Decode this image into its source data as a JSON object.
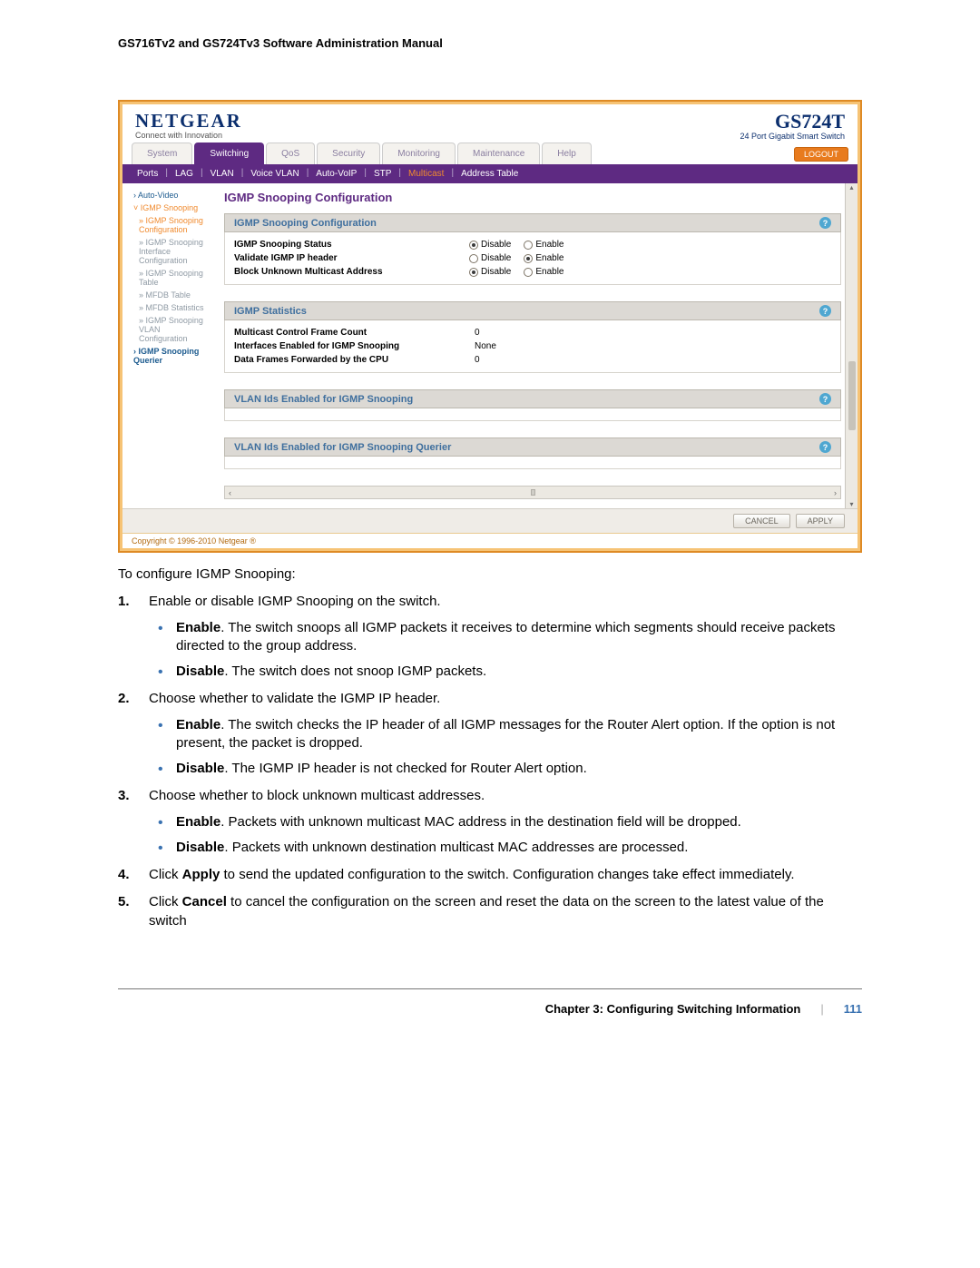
{
  "doc": {
    "header_title": "GS716Tv2 and GS724Tv3 Software Administration Manual"
  },
  "ui": {
    "brand": "NETGEAR",
    "brand_tagline": "Connect with Innovation",
    "model": "GS724T",
    "model_sub": "24 Port Gigabit Smart Switch",
    "logout": "LOGOUT",
    "main_tabs": [
      "System",
      "Switching",
      "QoS",
      "Security",
      "Monitoring",
      "Maintenance",
      "Help"
    ],
    "main_active_index": 1,
    "sub_tabs": [
      "Ports",
      "LAG",
      "VLAN",
      "Voice VLAN",
      "Auto-VoIP",
      "STP",
      "Multicast",
      "Address Table"
    ],
    "sub_active_index": 6,
    "sidebar": {
      "auto_video": "Auto-Video",
      "igmp_snooping": "IGMP Snooping",
      "igmp_snooping_conf": "IGMP Snooping Configuration",
      "igmp_snooping_iface": "IGMP Snooping Interface Configuration",
      "igmp_snooping_table": "IGMP Snooping Table",
      "mfdb_table": "MFDB Table",
      "mfdb_stats": "MFDB Statistics",
      "igmp_snooping_vlan": "IGMP Snooping VLAN Configuration",
      "igmp_querier": "IGMP Snooping Querier"
    },
    "page_title": "IGMP Snooping Configuration",
    "section1": {
      "title": "IGMP Snooping Configuration",
      "rows": {
        "status_label": "IGMP Snooping Status",
        "validate_label": "Validate IGMP IP header",
        "block_label": "Block Unknown Multicast Address"
      },
      "opt_disable": "Disable",
      "opt_enable": "Enable",
      "selected": {
        "status": "Disable",
        "validate": "Enable",
        "block": "Disable"
      }
    },
    "section2": {
      "title": "IGMP Statistics",
      "rows": {
        "frame_count_label": "Multicast Control Frame Count",
        "frame_count_value": "0",
        "ifc_label": "Interfaces Enabled for IGMP Snooping",
        "ifc_value": "None",
        "cpu_label": "Data Frames Forwarded by the CPU",
        "cpu_value": "0"
      }
    },
    "section3": {
      "title": "VLAN Ids Enabled for IGMP Snooping"
    },
    "section4": {
      "title": "VLAN Ids Enabled for IGMP Snooping Querier"
    },
    "footer_buttons": {
      "cancel": "CANCEL",
      "apply": "APPLY"
    },
    "copyright": "Copyright © 1996-2010 Netgear ®"
  },
  "body": {
    "intro": "To configure IGMP Snooping:",
    "steps": [
      {
        "text": "Enable or disable IGMP Snooping on the switch.",
        "bullets": [
          {
            "bold": "Enable",
            "rest": ". The switch snoops all IGMP packets it receives to determine which segments should receive packets directed to the group address."
          },
          {
            "bold": "Disable",
            "rest": ". The switch does not snoop IGMP packets."
          }
        ]
      },
      {
        "text": "Choose whether to validate the IGMP IP header.",
        "bullets": [
          {
            "bold": "Enable",
            "rest": ". The switch checks the IP header of all IGMP messages for the Router Alert option. If the option is not present, the packet is dropped."
          },
          {
            "bold": "Disable",
            "rest": ". The IGMP IP header is not checked for Router Alert option."
          }
        ]
      },
      {
        "text": "Choose whether to block unknown multicast addresses.",
        "bullets": [
          {
            "bold": "Enable",
            "rest": ". Packets with unknown multicast MAC address in the destination field will be dropped."
          },
          {
            "bold": "Disable",
            "rest": ". Packets with unknown destination multicast MAC addresses are processed."
          }
        ]
      },
      {
        "text_pre": "Click ",
        "bold": "Apply",
        "text_post": " to send the updated configuration to the switch. Configuration changes take effect immediately."
      },
      {
        "text_pre": "Click ",
        "bold": "Cancel",
        "text_post": " to cancel the configuration on the screen and reset the data on the screen to the latest value of the switch"
      }
    ]
  },
  "page_footer": {
    "chapter": "Chapter 3:  Configuring Switching Information",
    "sep": "|",
    "page_no": "111"
  }
}
